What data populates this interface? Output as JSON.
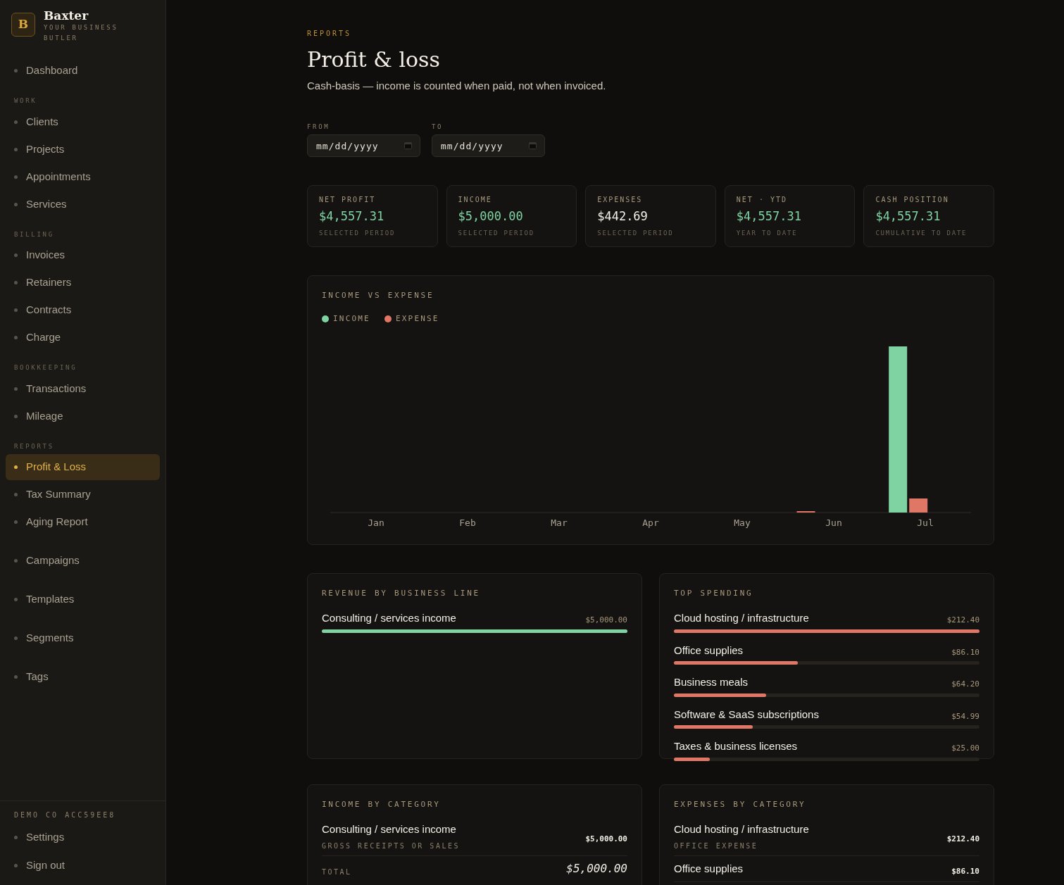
{
  "brand": {
    "logo_letter": "B",
    "name": "Baxter",
    "tagline": "YOUR BUSINESS BUTLER"
  },
  "sidebar": {
    "groups": [
      {
        "items": [
          {
            "label": "Dashboard",
            "selected": false
          }
        ]
      },
      {
        "heading": "WORK",
        "items": [
          {
            "label": "Clients",
            "selected": false
          },
          {
            "label": "Projects",
            "selected": false
          },
          {
            "label": "Appointments",
            "selected": false
          },
          {
            "label": "Services",
            "selected": false
          }
        ]
      },
      {
        "heading": "BILLING",
        "items": [
          {
            "label": "Invoices",
            "selected": false
          },
          {
            "label": "Retainers",
            "selected": false
          },
          {
            "label": "Contracts",
            "selected": false
          },
          {
            "label": "Charge",
            "selected": false
          }
        ]
      },
      {
        "heading": "BOOKKEEPING",
        "items": [
          {
            "label": "Transactions",
            "selected": false
          },
          {
            "label": "Mileage",
            "selected": false
          }
        ]
      },
      {
        "heading": "REPORTS",
        "items": [
          {
            "label": "Profit & Loss",
            "selected": true
          },
          {
            "label": "Tax Summary",
            "selected": false
          },
          {
            "label": "Aging Report",
            "selected": false
          }
        ]
      },
      {
        "items": [
          {
            "label": "Campaigns",
            "selected": false
          }
        ]
      },
      {
        "items": [
          {
            "label": "Templates",
            "selected": false
          }
        ]
      },
      {
        "items": [
          {
            "label": "Segments",
            "selected": false
          }
        ]
      },
      {
        "items": [
          {
            "label": "Tags",
            "selected": false
          }
        ]
      }
    ],
    "footer": {
      "account": "DEMO CO ACC59EE8",
      "items": [
        {
          "label": "Settings"
        },
        {
          "label": "Sign out"
        }
      ]
    }
  },
  "header": {
    "eyebrow": "REPORTS",
    "title": "Profit & loss",
    "subtitle": "Cash-basis — income is counted when paid, not when invoiced."
  },
  "filters": [
    {
      "label": "FROM",
      "placeholder": "mm/dd/yyyy"
    },
    {
      "label": "TO",
      "placeholder": "mm/dd/yyyy"
    }
  ],
  "stats": [
    {
      "label": "NET PROFIT",
      "value": "$4,557.31",
      "note": "SELECTED PERIOD",
      "color": "#7fd3a2"
    },
    {
      "label": "INCOME",
      "value": "$5,000.00",
      "note": "SELECTED PERIOD",
      "color": "#7fd3a2"
    },
    {
      "label": "EXPENSES",
      "value": "$442.69",
      "note": "SELECTED PERIOD",
      "color": "#f4efe6"
    },
    {
      "label": "NET · YTD",
      "value": "$4,557.31",
      "note": "YEAR TO DATE",
      "color": "#7fd3a2"
    },
    {
      "label": "CASH POSITION",
      "value": "$4,557.31",
      "note": "CUMULATIVE TO DATE",
      "color": "#7fd3a2"
    }
  ],
  "chart": {
    "title": "INCOME VS EXPENSE",
    "legend": [
      {
        "label": "INCOME",
        "color": "#7fd3a2"
      },
      {
        "label": "EXPENSE",
        "color": "#e07766"
      }
    ],
    "months": [
      "Jan",
      "Feb",
      "Mar",
      "Apr",
      "May",
      "Jun",
      "Jul"
    ]
  },
  "revenue": {
    "title": "REVENUE BY BUSINESS LINE",
    "rows": [
      {
        "label": "Consulting / services income",
        "amount": "$5,000.00",
        "level": 1
      }
    ]
  },
  "spending": {
    "title": "TOP SPENDING",
    "rows": [
      {
        "label": "Cloud hosting / infrastructure",
        "amount": "$212.40",
        "level": 1
      },
      {
        "label": "Office supplies",
        "amount": "$86.10",
        "level": 0.405
      },
      {
        "label": "Business meals",
        "amount": "$64.20",
        "level": 0.302
      },
      {
        "label": "Software & SaaS subscriptions",
        "amount": "$54.99",
        "level": 0.259
      },
      {
        "label": "Taxes & business licenses",
        "amount": "$25.00",
        "level": 0.118
      }
    ]
  },
  "income_by_category": {
    "title": "INCOME BY CATEGORY",
    "rows": [
      {
        "label": "Consulting / services income",
        "sublabel": "GROSS RECEIPTS OR SALES",
        "amount": "$5,000.00"
      }
    ],
    "total_label": "TOTAL",
    "total": "$5,000.00"
  },
  "expenses_by_category": {
    "title": "EXPENSES BY CATEGORY",
    "rows": [
      {
        "label": "Cloud hosting / infrastructure",
        "sublabel": "OFFICE EXPENSE",
        "amount": "$212.40"
      },
      {
        "label": "Office supplies",
        "amount": "$86.10"
      }
    ]
  }
}
